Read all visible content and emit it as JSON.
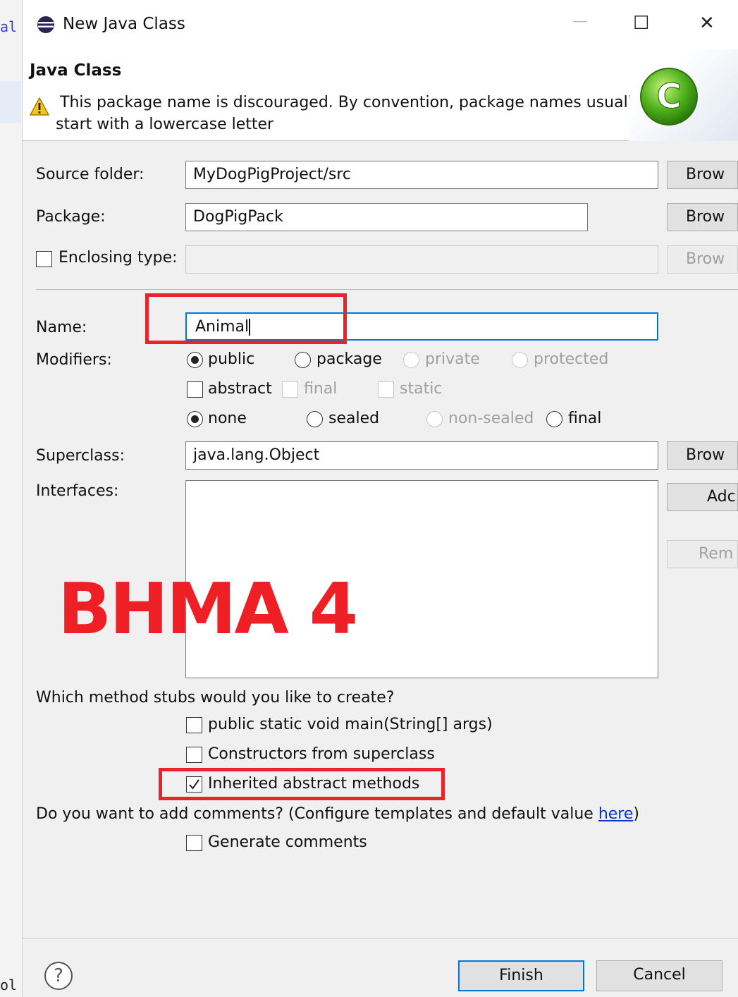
{
  "background_code": {
    "line1": "al",
    "line2": "ol"
  },
  "window": {
    "title": "New Java Class",
    "minimize_glyph": "—",
    "maximize_glyph": "☐",
    "close_glyph": "✕",
    "icon": "eclipse-icon"
  },
  "header": {
    "title": "Java Class",
    "warning_line1": "This package name is discouraged. By convention, package names usually",
    "warning_line2": "start with a lowercase letter",
    "warning_icon": "warning-triangle-icon",
    "banner_icon": "new-class-c-icon",
    "banner_letter": "C"
  },
  "form": {
    "source_folder": {
      "label": "Source folder:",
      "value": "MyDogPigProject/src",
      "button": "Brow"
    },
    "package": {
      "label": "Package:",
      "value": "DogPigPack",
      "button": "Brow"
    },
    "enclosing_type": {
      "label": "Enclosing type:",
      "value": "",
      "button": "Brow",
      "checked": false
    },
    "name": {
      "label": "Name:",
      "value": "Animal"
    },
    "modifiers": {
      "label": "Modifiers:",
      "access": [
        "public",
        "package",
        "private",
        "protected"
      ],
      "access_selected": "public",
      "flags": [
        "abstract",
        "final",
        "static"
      ],
      "kind": [
        "none",
        "sealed",
        "non-sealed",
        "final"
      ],
      "kind_selected": "none"
    },
    "superclass": {
      "label": "Superclass:",
      "value": "java.lang.Object",
      "button": "Brow"
    },
    "interfaces": {
      "label": "Interfaces:",
      "add_button": "Adc",
      "remove_button": "Rem"
    }
  },
  "stubs": {
    "question": "Which method stubs would you like to create?",
    "main": {
      "label": "public static void main(String[] args)",
      "checked": false
    },
    "constructors": {
      "label": "Constructors from superclass",
      "checked": false
    },
    "inherited": {
      "label": "Inherited abstract methods",
      "checked": true
    }
  },
  "comments": {
    "question_prefix": "Do you want to add comments? (Configure templates and default value ",
    "link": "here",
    "question_suffix": ")",
    "generate": {
      "label": "Generate comments",
      "checked": false
    }
  },
  "footer": {
    "help_icon": "help-icon",
    "help_glyph": "?",
    "finish": "Finish",
    "cancel": "Cancel"
  },
  "overlay": {
    "watermark": "BHMA 4",
    "annotation_color": "#e8242b"
  },
  "colors": {
    "focus": "#0078d7",
    "dialog_bg": "#f0f0f0",
    "link": "#0033cc"
  }
}
